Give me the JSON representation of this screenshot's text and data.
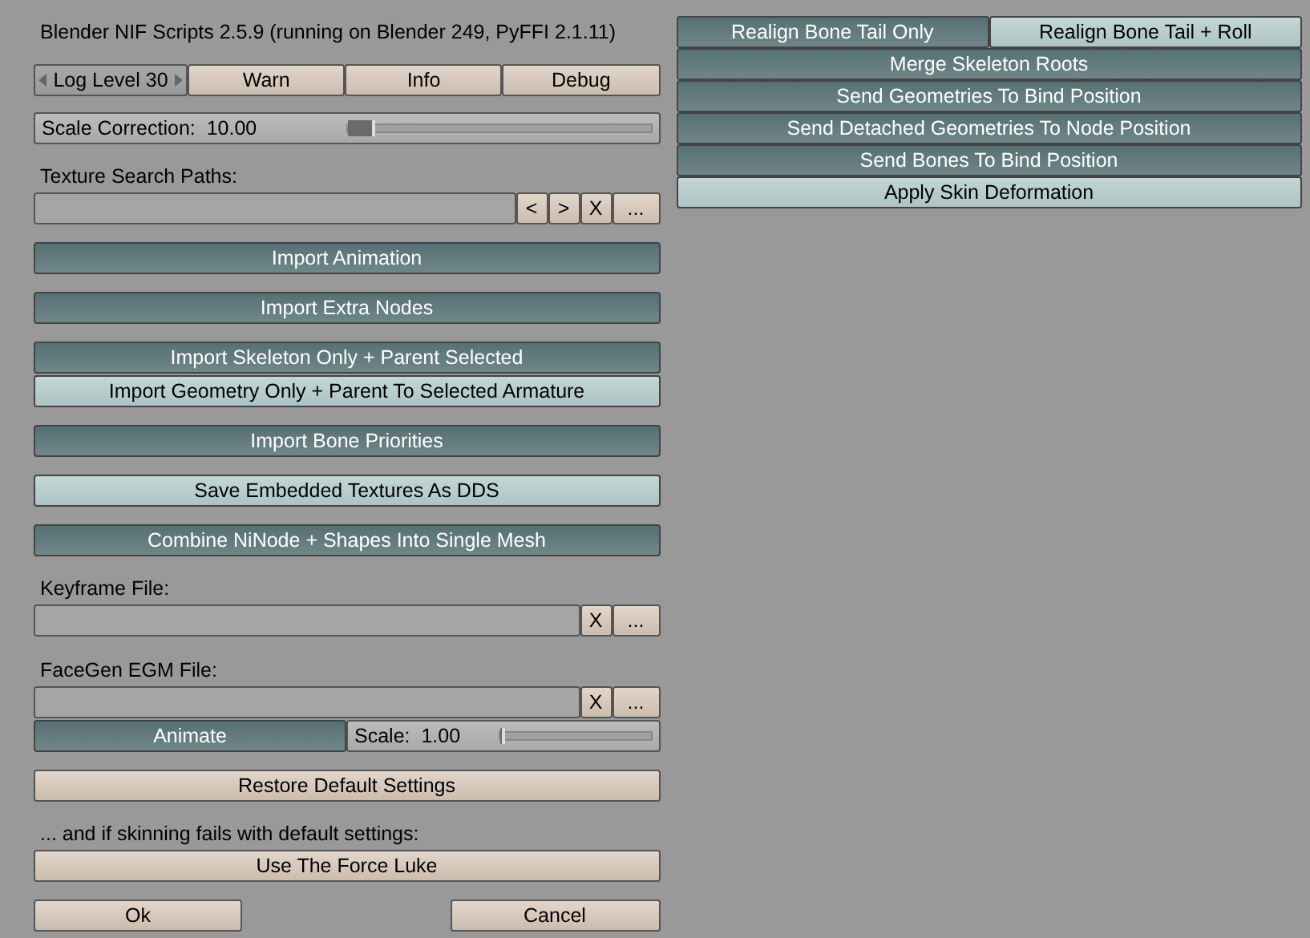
{
  "header": {
    "title": "Blender NIF Scripts 2.5.9 (running on Blender 249, PyFFI 2.1.11)"
  },
  "log_level": {
    "label": "Log Level 30",
    "buttons": [
      {
        "label": "Warn"
      },
      {
        "label": "Info"
      },
      {
        "label": "Debug"
      }
    ]
  },
  "scale_correction": {
    "label": "Scale Correction:",
    "value": "10.00",
    "level": 0.02
  },
  "texture_search_paths": {
    "label": "Texture Search Paths:",
    "buttons": [
      "<",
      ">",
      "X",
      "..."
    ]
  },
  "import_groups": [
    {
      "toggles": [
        {
          "label": "Import Animation",
          "on": true
        }
      ]
    },
    {
      "toggles": [
        {
          "label": "Import Extra Nodes",
          "on": true
        }
      ]
    },
    {
      "toggles": [
        {
          "label": "Import Skeleton Only + Parent Selected",
          "on": true
        },
        {
          "label": "Import Geometry Only + Parent To Selected Armature",
          "on": false
        }
      ]
    },
    {
      "toggles": [
        {
          "label": "Import Bone Priorities",
          "on": true
        }
      ]
    },
    {
      "toggles": [
        {
          "label": "Save Embedded Textures As DDS",
          "on": false
        }
      ]
    },
    {
      "toggles": [
        {
          "label": "Combine NiNode + Shapes Into Single Mesh",
          "on": true
        }
      ]
    }
  ],
  "keyframe_file": {
    "label": "Keyframe File:",
    "buttons": [
      "X",
      "..."
    ]
  },
  "facegen_egm_file": {
    "label": "FaceGen EGM File:",
    "buttons": [
      "X",
      "..."
    ],
    "animate": {
      "label": "Animate",
      "on": true
    },
    "scale": {
      "label": "Scale:",
      "value": "1.00",
      "level": 0.0
    }
  },
  "restore_button": "Restore Default Settings",
  "fallback": {
    "label": "... and if skinning fails with default settings:",
    "button": "Use The Force Luke"
  },
  "dialog_buttons": [
    "Ok",
    "Cancel"
  ],
  "skeleton_tools": {
    "realign": [
      {
        "label": "Realign Bone Tail Only",
        "selected": true
      },
      {
        "label": "Realign Bone Tail + Roll",
        "selected": false
      }
    ],
    "toggles": [
      {
        "label": "Merge Skeleton Roots",
        "on": true
      },
      {
        "label": "Send Geometries To Bind Position",
        "on": true
      },
      {
        "label": "Send Detached Geometries To Node Position",
        "on": true
      },
      {
        "label": "Send Bones To Bind Position",
        "on": true
      },
      {
        "label": "Apply Skin Deformation",
        "on": false
      }
    ]
  }
}
